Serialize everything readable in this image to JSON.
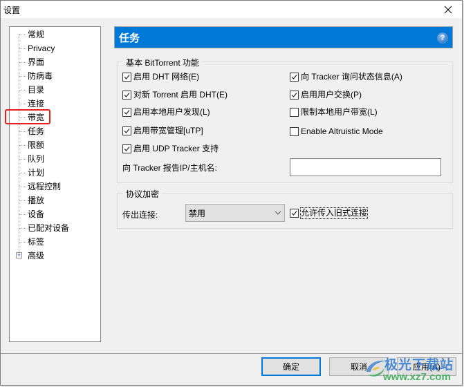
{
  "window": {
    "title": "设置",
    "close_icon": "close-icon"
  },
  "sidebar": {
    "items": [
      {
        "label": "常规"
      },
      {
        "label": "Privacy"
      },
      {
        "label": "界面"
      },
      {
        "label": "防病毒"
      },
      {
        "label": "目录"
      },
      {
        "label": "连接"
      },
      {
        "label": "带宽",
        "highlighted": true
      },
      {
        "label": "任务",
        "selected": true
      },
      {
        "label": "限额"
      },
      {
        "label": "队列"
      },
      {
        "label": "计划"
      },
      {
        "label": "远程控制"
      },
      {
        "label": "播放"
      },
      {
        "label": "设备"
      },
      {
        "label": "已配对设备"
      },
      {
        "label": "标签"
      },
      {
        "label": "高级",
        "expandable": true,
        "expander": "+"
      }
    ]
  },
  "header": {
    "title": "任务",
    "help_icon": "?",
    "color": "#0078d7"
  },
  "basic_group": {
    "legend": "基本 BitTorrent 功能",
    "left_options": [
      {
        "label": "启用 DHT 网络(E)",
        "checked": true
      },
      {
        "label": "对新 Torrent 启用 DHT(E)",
        "checked": true
      },
      {
        "label": "启用本地用户发现(L)",
        "checked": true
      },
      {
        "label": "启用带宽管理[uTP]",
        "checked": true
      },
      {
        "label": "启用 UDP Tracker 支持",
        "checked": true
      }
    ],
    "right_options": [
      {
        "label": "向 Tracker 询问状态信息(A)",
        "checked": true
      },
      {
        "label": "启用用户交换(P)",
        "checked": true
      },
      {
        "label": "限制本地用户带宽(L)",
        "checked": false
      },
      {
        "label": "Enable Altruistic Mode",
        "checked": false
      }
    ],
    "report_ip_label": "向 Tracker 报告IP/主机名:",
    "report_ip_value": ""
  },
  "encryption_group": {
    "legend": "协议加密",
    "outgoing_label": "传出连接:",
    "outgoing_value": "禁用",
    "allow_legacy_label": "允许传入旧式连接",
    "allow_legacy_checked": true
  },
  "footer": {
    "ok_label": "确定",
    "cancel_label": "取消",
    "apply_label": "应用(A)"
  },
  "watermark": {
    "line1": "极光下载站",
    "line2": "www.xz7.com"
  },
  "colors": {
    "accent": "#0078d7",
    "highlight_box": "#e3211c"
  }
}
